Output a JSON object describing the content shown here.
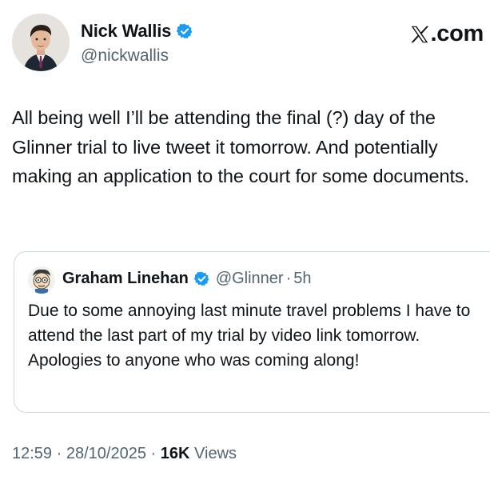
{
  "author": {
    "name": "Nick Wallis",
    "handle": "@nickwallis",
    "verified": true,
    "avatar": "profile-photo"
  },
  "brand": {
    "icon": "x-logo-icon",
    "label": ".com"
  },
  "tweet": {
    "text": "All being well I’ll be attending the final (?) day of the Glinner trial to live tweet it tomorrow. And potentially making an application to the court for some documents."
  },
  "quote": {
    "name": "Graham Linehan",
    "handle": "@Glinner",
    "separator": "·",
    "time": "5h",
    "verified": true,
    "text": "Due to some annoying last minute travel problems I have to attend the last part of my trial by video link tomorrow. Apologies to anyone who was coming along!"
  },
  "meta": {
    "time": "12:59",
    "dot1": "·",
    "date": "28/10/2025",
    "dot2": "·",
    "views_count": "16K",
    "views_label": "Views"
  },
  "colors": {
    "verified": "#1d9bf0",
    "secondary_text": "#536471",
    "border": "#cfd9de"
  }
}
